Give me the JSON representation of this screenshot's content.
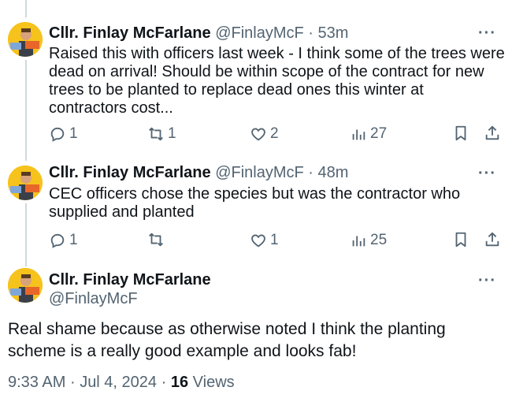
{
  "colors": {
    "text": "#0f1419",
    "secondary": "#536471",
    "line": "#cfd9de",
    "avatar_bg": "#f6c21c"
  },
  "replies": [
    {
      "name": "Cllr. Finlay McFarlane",
      "handle": "@FinlayMcF",
      "sep": "·",
      "time": "53m",
      "text": "Raised this with officers last week - I think some of the trees were dead on arrival! Should be within scope of the contract for new trees to be planted to replace dead ones this winter at contractors cost...",
      "more_icon": "···",
      "reply_count": "1",
      "repost_count": "1",
      "like_count": "2",
      "view_count": "27"
    },
    {
      "name": "Cllr. Finlay McFarlane",
      "handle": "@FinlayMcF",
      "sep": "·",
      "time": "48m",
      "text": "CEC officers chose the species but was the contractor who supplied and planted",
      "more_icon": "···",
      "reply_count": "1",
      "repost_count": "",
      "like_count": "1",
      "view_count": "25"
    }
  ],
  "main_post": {
    "name": "Cllr. Finlay McFarlane",
    "handle": "@FinlayMcF",
    "more_icon": "···",
    "text": "Real shame because as otherwise noted I think the planting scheme is a really good example and looks fab!",
    "time": "9:33 AM",
    "sep1": "·",
    "date": "Jul 4, 2024",
    "sep2": "·",
    "views_count": "16",
    "views_label": "Views"
  }
}
